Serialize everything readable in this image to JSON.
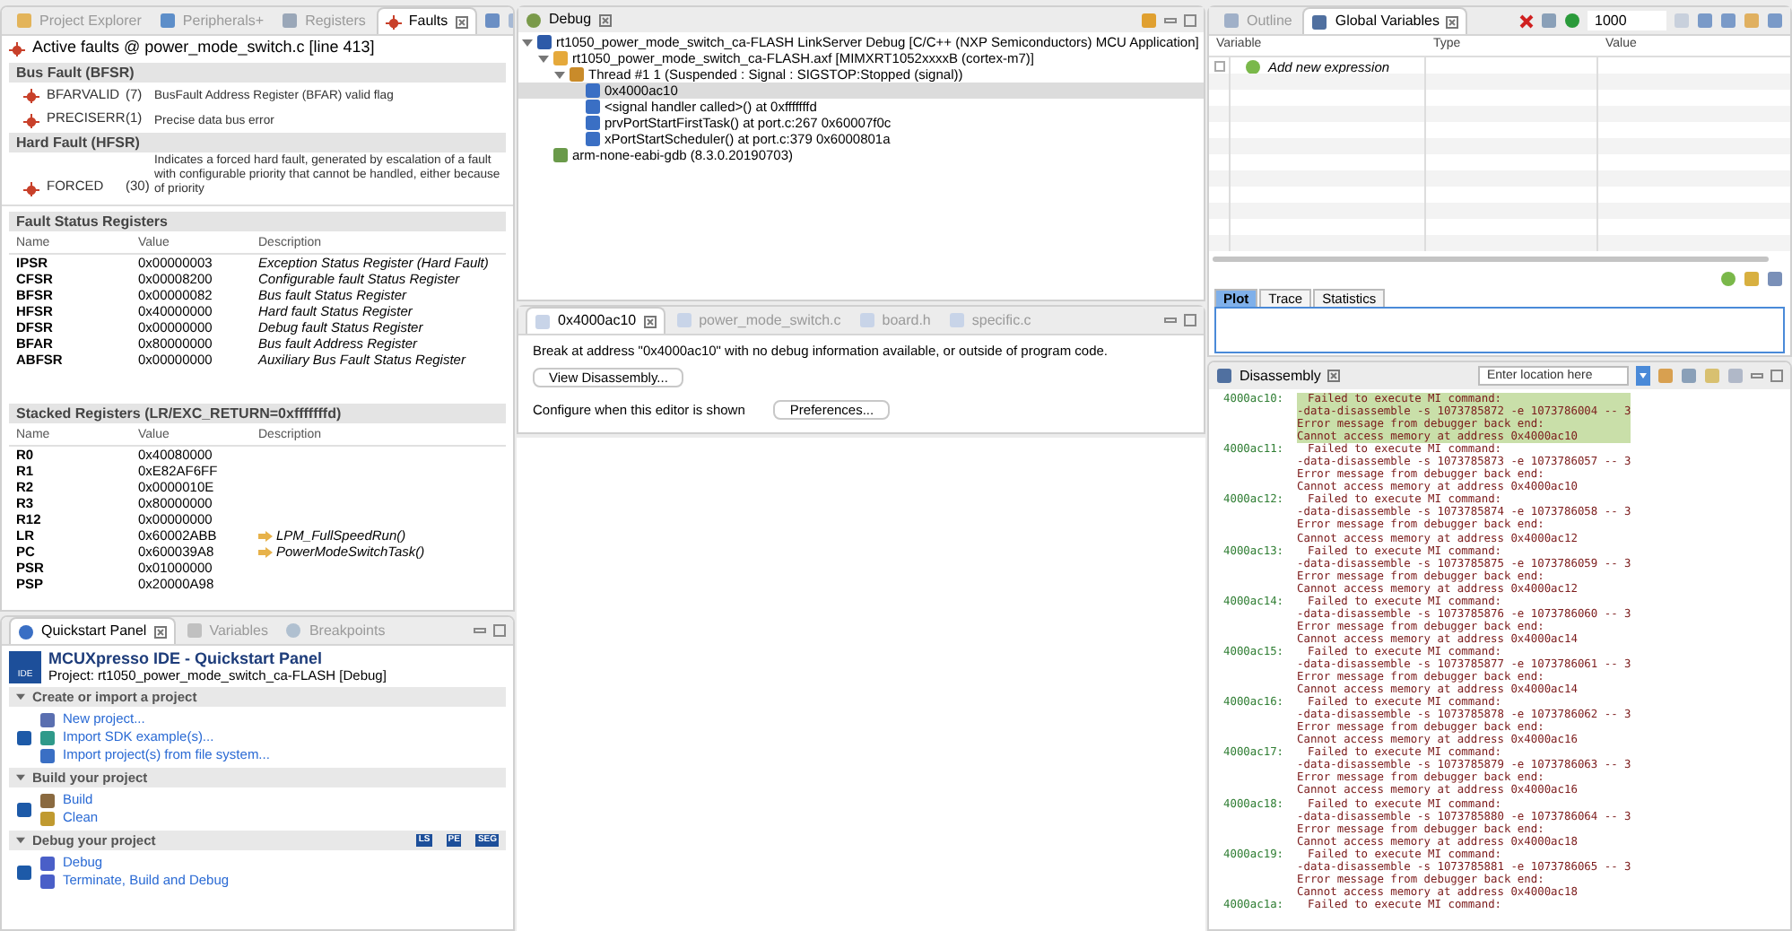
{
  "faults_view": {
    "tabs": [
      {
        "label": "Project Explorer",
        "selected": false
      },
      {
        "label": "Peripherals+",
        "selected": false
      },
      {
        "label": "Registers",
        "selected": false
      },
      {
        "label": "Faults",
        "selected": true
      }
    ],
    "title": "Active faults @ power_mode_switch.c [line 413]",
    "groups": [
      {
        "title": "Bus Fault (BFSR)",
        "items": [
          {
            "name": "BFARVALID",
            "code": "(7)",
            "description": "BusFault Address Register (BFAR) valid flag"
          },
          {
            "name": "PRECISERR",
            "code": "(1)",
            "description": "Precise data bus error"
          }
        ]
      },
      {
        "title": "Hard Fault (HFSR)",
        "items": [
          {
            "name": "FORCED",
            "code": "(30)",
            "description": "Indicates a forced hard fault, generated by escalation of a fault with configurable priority that cannot be handled, either because of priority"
          }
        ]
      }
    ],
    "tables": [
      {
        "title": "Fault Status Registers",
        "columns": [
          "Name",
          "Value",
          "Description"
        ],
        "rows": [
          {
            "name": "IPSR",
            "value": "0x00000003",
            "description": "Exception Status Register (Hard Fault)",
            "link": false
          },
          {
            "name": "CFSR",
            "value": "0x00008200",
            "description": "Configurable fault Status Register",
            "link": false
          },
          {
            "name": "BFSR",
            "value": "0x00000082",
            "description": "Bus fault Status Register",
            "link": false
          },
          {
            "name": "HFSR",
            "value": "0x40000000",
            "description": "Hard fault Status Register",
            "link": false
          },
          {
            "name": "DFSR",
            "value": "0x00000000",
            "description": "Debug fault Status Register",
            "link": false
          },
          {
            "name": "BFAR",
            "value": "0x80000000",
            "description": "Bus fault Address Register",
            "link": false
          },
          {
            "name": "ABFSR",
            "value": "0x00000000",
            "description": "Auxiliary Bus Fault Status Register",
            "link": false
          }
        ]
      },
      {
        "title": "Stacked Registers (LR/EXC_RETURN=0xfffffffd)",
        "columns": [
          "Name",
          "Value",
          "Description"
        ],
        "rows": [
          {
            "name": "R0",
            "value": "0x40080000"
          },
          {
            "name": "R1",
            "value": "0xE82AF6FF"
          },
          {
            "name": "R2",
            "value": "0x0000010E"
          },
          {
            "name": "R3",
            "value": "0x80000000"
          },
          {
            "name": "R12",
            "value": "0x00000000"
          },
          {
            "name": "LR",
            "value": "0x60002ABB",
            "description": "LPM_FullSpeedRun()",
            "link": true
          },
          {
            "name": "PC",
            "value": "0x600039A8",
            "description": "PowerModeSwitchTask()",
            "link": true
          },
          {
            "name": "PSR",
            "value": "0x01000000"
          },
          {
            "name": "PSP",
            "value": "0x20000A98"
          }
        ]
      }
    ]
  },
  "quickstart": {
    "tabs": [
      {
        "label": "Quickstart Panel",
        "selected": true
      },
      {
        "label": "Variables",
        "selected": false
      },
      {
        "label": "Breakpoints",
        "selected": false
      }
    ],
    "title": "MCUXpresso IDE - Quickstart Panel",
    "project": "Project: rt1050_power_mode_switch_ca-FLASH [Debug]",
    "logo_label": "IDE",
    "sections": [
      {
        "title": "Create or import a project",
        "expanded": true,
        "links": [
          "New project...",
          "Import SDK example(s)...",
          "Import project(s) from file system..."
        ]
      },
      {
        "title": "Build your project",
        "expanded": true,
        "links": [
          "Build",
          "Clean"
        ]
      },
      {
        "title": "Debug your project",
        "expanded": true,
        "links": [
          "Debug",
          "Terminate, Build and Debug"
        ],
        "tools": [
          "LS",
          "PE",
          "SEG"
        ]
      }
    ]
  },
  "debug_view": {
    "title": "Debug",
    "tree": [
      {
        "label": "rt1050_power_mode_switch_ca-FLASH LinkServer Debug [C/C++ (NXP Semiconductors) MCU Application]",
        "kind": "launch",
        "selected": false,
        "expanded": true,
        "children": [
          {
            "label": "rt1050_power_mode_switch_ca-FLASH.axf [MIMXRT1052xxxxB (cortex-m7)]",
            "kind": "target",
            "selected": false,
            "expanded": true,
            "children": [
              {
                "label": "Thread #1 1 (Suspended : Signal : SIGSTOP:Stopped (signal))",
                "kind": "thread",
                "selected": false,
                "expanded": true,
                "children": [
                  {
                    "label": "0x4000ac10",
                    "kind": "frame",
                    "selected": true
                  },
                  {
                    "label": "<signal handler called>() at 0xfffffffd",
                    "kind": "frame",
                    "selected": false
                  },
                  {
                    "label": "prvPortStartFirstTask() at port.c:267 0x60007f0c",
                    "kind": "frame",
                    "selected": false
                  },
                  {
                    "label": "xPortStartScheduler() at port.c:379 0x6000801a",
                    "kind": "frame",
                    "selected": false
                  }
                ]
              }
            ]
          },
          {
            "label": "arm-none-eabi-gdb (8.3.0.20190703)",
            "kind": "process",
            "selected": false
          }
        ]
      }
    ]
  },
  "editor": {
    "tabs": [
      {
        "label": "0x4000ac10",
        "selected": true
      },
      {
        "label": "power_mode_switch.c",
        "selected": false
      },
      {
        "label": "board.h",
        "selected": false
      },
      {
        "label": "specific.c",
        "selected": false
      }
    ],
    "message": "Break at address \"0x4000ac10\" with no debug information available, or outside of program code.",
    "view_button": "View Disassembly...",
    "configure_label": "Configure when this editor is shown",
    "preferences_button": "Preferences..."
  },
  "variables_view": {
    "tabs": [
      {
        "label": "Outline",
        "selected": false
      },
      {
        "label": "Global Variables",
        "selected": true
      }
    ],
    "refresh_value": "1000",
    "columns": [
      "Variable",
      "Type",
      "Value"
    ],
    "add_expression": "Add new expression",
    "add_checked": false,
    "plot_tabs": [
      {
        "label": "Plot",
        "selected": true
      },
      {
        "label": "Trace",
        "selected": false
      },
      {
        "label": "Statistics",
        "selected": false
      }
    ]
  },
  "disassembly": {
    "title": "Disassembly",
    "location_placeholder": "Enter location here",
    "entries": [
      {
        "address": "4000ac10:",
        "lines": [
          "Failed to execute MI command:",
          "-data-disassemble -s 1073785872 -e 1073786004 -- 3",
          "Error message from debugger back end:",
          "Cannot access memory at address 0x4000ac10"
        ],
        "selected": true
      },
      {
        "address": "4000ac11:",
        "lines": [
          "Failed to execute MI command:",
          "-data-disassemble -s 1073785873 -e 1073786057 -- 3",
          "Error message from debugger back end:",
          "Cannot access memory at address 0x4000ac10"
        ],
        "selected": false
      },
      {
        "address": "4000ac12:",
        "lines": [
          "Failed to execute MI command:",
          "-data-disassemble -s 1073785874 -e 1073786058 -- 3",
          "Error message from debugger back end:",
          "Cannot access memory at address 0x4000ac12"
        ],
        "selected": false
      },
      {
        "address": "4000ac13:",
        "lines": [
          "Failed to execute MI command:",
          "-data-disassemble -s 1073785875 -e 1073786059 -- 3",
          "Error message from debugger back end:",
          "Cannot access memory at address 0x4000ac12"
        ],
        "selected": false
      },
      {
        "address": "4000ac14:",
        "lines": [
          "Failed to execute MI command:",
          "-data-disassemble -s 1073785876 -e 1073786060 -- 3",
          "Error message from debugger back end:",
          "Cannot access memory at address 0x4000ac14"
        ],
        "selected": false
      },
      {
        "address": "4000ac15:",
        "lines": [
          "Failed to execute MI command:",
          "-data-disassemble -s 1073785877 -e 1073786061 -- 3",
          "Error message from debugger back end:",
          "Cannot access memory at address 0x4000ac14"
        ],
        "selected": false
      },
      {
        "address": "4000ac16:",
        "lines": [
          "Failed to execute MI command:",
          "-data-disassemble -s 1073785878 -e 1073786062 -- 3",
          "Error message from debugger back end:",
          "Cannot access memory at address 0x4000ac16"
        ],
        "selected": false
      },
      {
        "address": "4000ac17:",
        "lines": [
          "Failed to execute MI command:",
          "-data-disassemble -s 1073785879 -e 1073786063 -- 3",
          "Error message from debugger back end:",
          "Cannot access memory at address 0x4000ac16"
        ],
        "selected": false
      },
      {
        "address": "4000ac18:",
        "lines": [
          "Failed to execute MI command:",
          "-data-disassemble -s 1073785880 -e 1073786064 -- 3",
          "Error message from debugger back end:",
          "Cannot access memory at address 0x4000ac18"
        ],
        "selected": false
      },
      {
        "address": "4000ac19:",
        "lines": [
          "Failed to execute MI command:",
          "-data-disassemble -s 1073785881 -e 1073786065 -- 3",
          "Error message from debugger back end:",
          "Cannot access memory at address 0x4000ac18"
        ],
        "selected": false
      },
      {
        "address": "4000ac1a:",
        "lines": [
          "Failed to execute MI command:"
        ],
        "selected": false
      }
    ]
  }
}
